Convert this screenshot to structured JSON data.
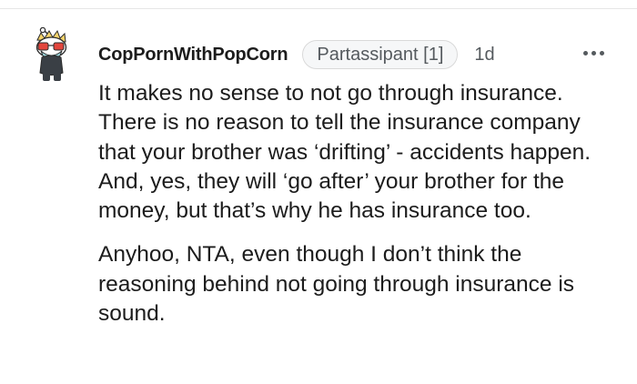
{
  "comment": {
    "author": "CopPornWithPopCorn",
    "flair": "Partassipant [1]",
    "timestamp": "1d",
    "more_icon": "more-horizontal-icon",
    "avatar_icon": "snoo-avatar-icon",
    "paragraphs": [
      "It makes no sense to not go through insurance. There is no reason to tell the insurance company that your brother was ‘drifting’ - accidents happen. And, yes, they will ‘go after’ your brother for the money, but that’s why he has insurance too.",
      "Anyhoo, NTA, even though I don’t think the reasoning behind not going through insurance is sound."
    ]
  },
  "colors": {
    "text": "#1c1c1c",
    "meta": "#555a5e",
    "flair_border": "#d9d9d9",
    "flair_bg": "#f6f7f8",
    "divider": "#e6e6e6"
  }
}
